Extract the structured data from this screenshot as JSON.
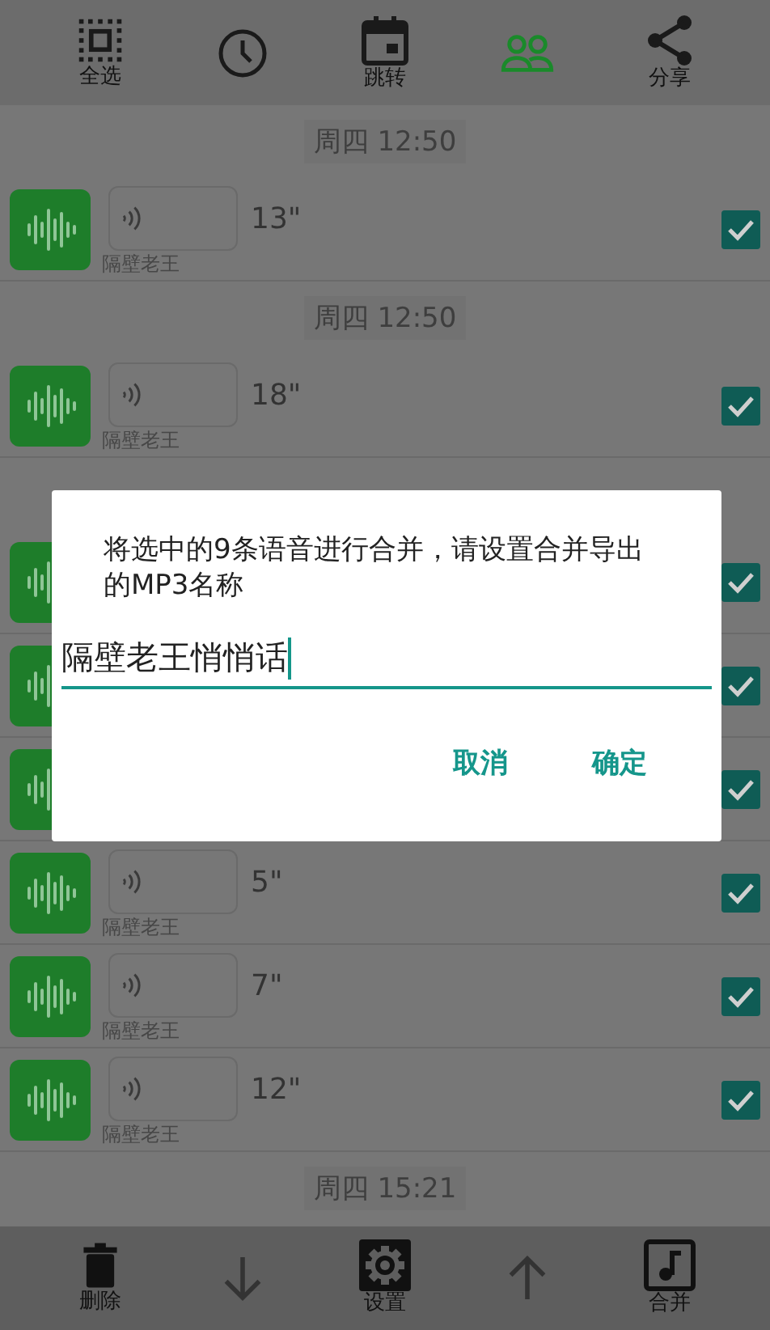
{
  "toolbar": [
    {
      "kind": "select-all",
      "label": "全选",
      "on": false
    },
    {
      "kind": "clock",
      "on": false
    },
    {
      "kind": "calendar",
      "label": "跳转",
      "on": false
    },
    {
      "kind": "people",
      "on": true
    },
    {
      "kind": "share",
      "label": "分享",
      "on": false
    }
  ],
  "groups": [
    {
      "time": "周四 12:50",
      "rows": [
        {
          "duration": "13\"",
          "sender": "隔壁老王",
          "checked": true
        }
      ]
    },
    {
      "time": "周四 12:50",
      "rows": [
        {
          "duration": "18\"",
          "sender": "隔壁老王",
          "checked": true
        }
      ]
    },
    {
      "rows": [
        {
          "checked": true
        },
        {
          "checked": true
        },
        {
          "checked": true
        },
        {
          "duration": "5\"",
          "sender": "隔壁老王",
          "checked": true
        },
        {
          "duration": "7\"",
          "sender": "隔壁老王",
          "checked": true
        },
        {
          "duration": "12\"",
          "sender": "隔壁老王",
          "checked": true
        }
      ]
    },
    {
      "time": "周四 15:21"
    }
  ],
  "dialog": {
    "message": "将选中的9条语音进行合并，请设置合并导出的MP3名称",
    "value": "隔壁老王悄悄话",
    "buttons": [
      "取消",
      "确定"
    ]
  },
  "bottom_bar": [
    {
      "kind": "delete",
      "label": "删除"
    },
    {
      "kind": "down"
    },
    {
      "kind": "settings",
      "label": "设置"
    },
    {
      "kind": "up"
    },
    {
      "kind": "music",
      "label": "合并"
    }
  ]
}
